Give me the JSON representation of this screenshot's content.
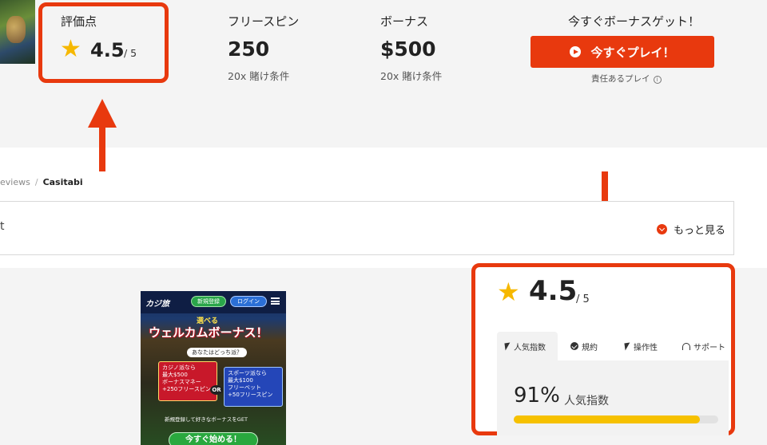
{
  "summary": {
    "rating": {
      "label": "評価点",
      "value": "4.5",
      "max": "/ 5"
    },
    "free_spins": {
      "label": "フリースピン",
      "value": "250",
      "wagering": "20x 賭け条件"
    },
    "bonus": {
      "label": "ボーナス",
      "value": "$500",
      "wagering": "20x 賭け条件"
    },
    "cta": {
      "heading": "今すぐボーナスゲット！",
      "button_label": "今すぐプレイ！",
      "responsible_link": "責任あるプレイ"
    }
  },
  "breadcrumb": {
    "previous": "eviews",
    "separator": "/",
    "current": "Casitabi"
  },
  "strip": {
    "left_fragment": "t",
    "more_label": "もっと見る"
  },
  "promo": {
    "logo": "カジ旅",
    "signup_pill": "新規登録",
    "login_pill": "ログイン",
    "subtitle": "選べる",
    "title": "ウェルカムボーナス！",
    "question": "あなたはどっち派？",
    "casino_card": {
      "tag": "カジノ派なら",
      "line1": "最大$500",
      "line2": "ボーナスマネー",
      "line3": "+250フリースピン"
    },
    "or_label": "OR",
    "sports_card": {
      "tag": "スポーツ派なら",
      "line1": "最大$100",
      "line2": "フリーベット",
      "line3": "+50フリースピン"
    },
    "footnote": "新規登録して好きなボーナスをGET",
    "cta_label": "今すぐ始める！"
  },
  "rating_card": {
    "value": "4.5",
    "max": "/ 5",
    "tabs": [
      {
        "label": "人気指数",
        "icon": "cursor-icon",
        "active": true
      },
      {
        "label": "規約",
        "icon": "check-circle-icon",
        "active": false
      },
      {
        "label": "操作性",
        "icon": "cursor-icon",
        "active": false
      },
      {
        "label": "サポート",
        "icon": "headset-icon",
        "active": false
      }
    ],
    "metric": {
      "value": "91%",
      "label": "人気指数",
      "fraction": 0.91
    }
  },
  "colors": {
    "accent": "#e8390e",
    "star": "#f6b800",
    "bar_fill": "#f6c100",
    "background_gray": "#f4f4f4"
  }
}
